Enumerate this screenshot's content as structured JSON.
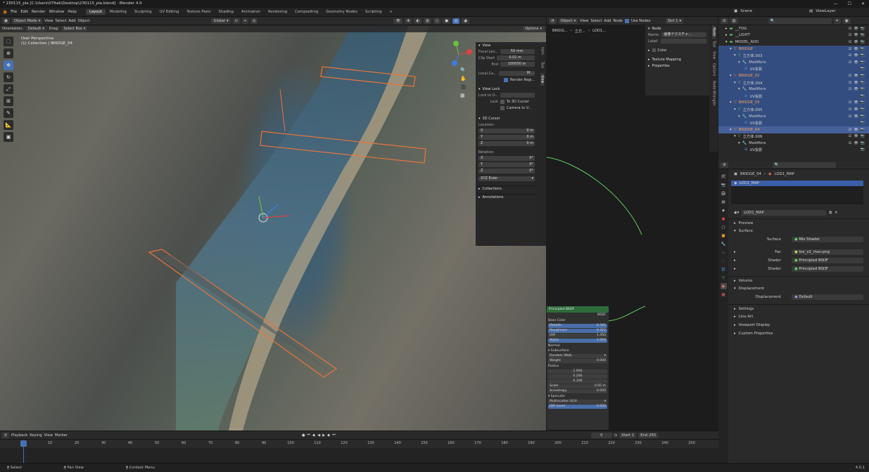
{
  "window": {
    "title": "* 230115_pla [C:\\Users\\07ltak\\Desktop\\230115_pla.blend] - Blender 4.0",
    "version": "4.0.1"
  },
  "menu": {
    "items": [
      "File",
      "Edit",
      "Render",
      "Window",
      "Help"
    ],
    "workspaces": [
      "Layout",
      "Modeling",
      "Sculpting",
      "UV Editing",
      "Texture Paint",
      "Shading",
      "Animation",
      "Rendering",
      "Compositing",
      "Geometry Nodes",
      "Scripting"
    ],
    "add": "+"
  },
  "scene": {
    "label": "Scene",
    "viewlayer": "ViewLayer"
  },
  "viewport": {
    "mode": "Object Mode",
    "menus": [
      "View",
      "Select",
      "Add",
      "Object"
    ],
    "transform": "Global",
    "orientation_label": "Orientation:",
    "orientation": "Default",
    "drag_label": "Drag:",
    "drag": "Select Box",
    "options": "Options",
    "overlay_title": "User Perspective",
    "overlay_sub": "(1) Collection | BRIDGE_04"
  },
  "npanel": {
    "view": "View",
    "focal_label": "Focal Len...",
    "focal": "50 mm",
    "clip_start_label": "Clip Start",
    "clip_start": "0.01 m",
    "end_label": "End",
    "end": "100000 m",
    "local_camera": "Local Ca...",
    "m": "M...",
    "render_region": "Render Regi...",
    "view_lock": "View Lock",
    "lock_to": "Lock to O...",
    "lock": "Lock",
    "to_3d": "To 3D Cursor",
    "cam_to": "Camera to V...",
    "cursor": "3D Cursor",
    "location": "Location:",
    "rotation": "Rotation:",
    "x": "X",
    "y": "Y",
    "z": "Z",
    "loc_x": "0 m",
    "loc_y": "0 m",
    "loc_z": "0 m",
    "rot_x": "0°",
    "rot_y": "0°",
    "rot_z": "0°",
    "euler": "XYZ Euler",
    "collections": "Collections",
    "annotations": "Annotations",
    "tabs": [
      "Item",
      "Tool",
      "View"
    ]
  },
  "nodeed": {
    "object": "Object",
    "menus": [
      "View",
      "Select",
      "Add",
      "Node"
    ],
    "use_nodes": "Use Nodes",
    "slot": "Slot 1",
    "crumbs": [
      "BRIDG...",
      "立方...",
      "LOD1..."
    ],
    "node": "Node",
    "name_label": "Name:",
    "name": "画像テクスチャ...",
    "label_label": "Label:",
    "color": "Color",
    "texture_mapping": "Texture Mapping",
    "properties": "Properties",
    "tabs": [
      "Node",
      "Tool",
      "View",
      "Options",
      "Node Wrangler"
    ]
  },
  "bsdf": {
    "title": "Principled BSDF",
    "out": "BSDF",
    "base_color": "Base Color",
    "metallic": "Metallic",
    "metallic_v": "0.341",
    "roughness": "Roughness",
    "roughness_v": "0.322",
    "ior": "IOR",
    "ior_v": "1.450",
    "alpha": "Alpha",
    "alpha_v": "1.000",
    "normal": "Normal",
    "subsurface": "Subsurface",
    "method": "Random Walk",
    "weight": "Weight",
    "weight_v": "0.000",
    "radius": "Radius",
    "r1": "1.000",
    "r2": "0.200",
    "r3": "0.100",
    "scale": "Scale",
    "scale_v": "0.05 m",
    "aniso": "Anisotropy",
    "aniso_v": "0.000",
    "specular": "Specular",
    "dist": "Multiscatter GGX",
    "ior_level": "IOR Level",
    "ior_level_v": "0.500"
  },
  "outliner": {
    "search": "",
    "rows": [
      {
        "name": "__FOG",
        "indent": 1,
        "sel": false,
        "icon": "▸"
      },
      {
        "name": "__LIGHT",
        "indent": 1,
        "sel": false,
        "icon": "▸"
      },
      {
        "name": "MODEL_ADD",
        "indent": 1,
        "sel": false,
        "icon": "▾"
      },
      {
        "name": "BRIDGE",
        "indent": 2,
        "sel": true,
        "icon": "▾",
        "orange": true
      },
      {
        "name": "立方体.003",
        "indent": 3,
        "sel": true,
        "icon": "▾"
      },
      {
        "name": "Modifiers",
        "indent": 4,
        "sel": true,
        "icon": "▾"
      },
      {
        "name": "UV投影",
        "indent": 5,
        "sel": true,
        "icon": ""
      },
      {
        "name": "BRIDGE_02",
        "indent": 2,
        "sel": true,
        "icon": "▾",
        "orange": true
      },
      {
        "name": "立方体.004",
        "indent": 3,
        "sel": true,
        "icon": "▾"
      },
      {
        "name": "Modifiers",
        "indent": 4,
        "sel": true,
        "icon": "▾"
      },
      {
        "name": "UV投影",
        "indent": 5,
        "sel": true,
        "icon": ""
      },
      {
        "name": "BRIDGE_03",
        "indent": 2,
        "sel": true,
        "icon": "▾",
        "orange": true
      },
      {
        "name": "立方体.005",
        "indent": 3,
        "sel": true,
        "icon": "▾"
      },
      {
        "name": "Modifiers",
        "indent": 4,
        "sel": true,
        "icon": "▾"
      },
      {
        "name": "UV投影",
        "indent": 5,
        "sel": true,
        "icon": ""
      },
      {
        "name": "BRIDGE_04",
        "indent": 2,
        "sel": true,
        "icon": "▾",
        "orange": true,
        "active": true
      },
      {
        "name": "立方体.006",
        "indent": 3,
        "sel": false,
        "icon": "▾"
      },
      {
        "name": "Modifiers",
        "indent": 4,
        "sel": false,
        "icon": "▾"
      },
      {
        "name": "UV投影",
        "indent": 5,
        "sel": false,
        "icon": ""
      }
    ]
  },
  "props": {
    "crumb_obj": "BRIDGE_04",
    "crumb_mat": "LOD1_MAP",
    "slot_name": "LOD1_MAP",
    "material": "LOD1_MAP",
    "preview": "Preview",
    "surface": "Surface",
    "surface_label": "Surface",
    "surface_v": "Mix Shader",
    "fac": "Fac",
    "fac_v": "tex_v2_river.png",
    "shader": "Shader",
    "shader1": "Principled BSDF",
    "shader2": "Principled BSDF",
    "volume": "Volume",
    "displacement": "Displacement",
    "disp_label": "Displacement",
    "disp_v": "Default",
    "settings": "Settings",
    "line_art": "Line Art",
    "viewport_display": "Viewport Display",
    "custom": "Custom Properties"
  },
  "timeline": {
    "menus": [
      "Playback",
      "Keying",
      "View",
      "Marker"
    ],
    "current": "0",
    "start_label": "Start",
    "start": "1",
    "end_label": "End",
    "end": "250",
    "ticks": [
      "0",
      "10",
      "20",
      "30",
      "40",
      "50",
      "60",
      "70",
      "80",
      "90",
      "100",
      "110",
      "120",
      "130",
      "140",
      "150",
      "160",
      "170",
      "180",
      "190",
      "200",
      "210",
      "220",
      "230",
      "240",
      "250"
    ]
  },
  "status": {
    "select": "Select",
    "pan": "Pan View",
    "context": "Context Menu"
  }
}
